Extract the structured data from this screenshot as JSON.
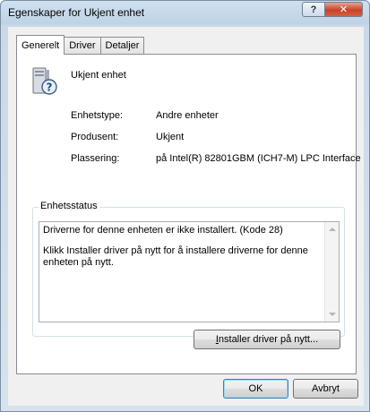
{
  "window": {
    "title": "Egenskaper for Ukjent enhet",
    "help_label": "?",
    "close_label": "✕"
  },
  "tabs": [
    {
      "label": "Generelt",
      "active": true
    },
    {
      "label": "Driver",
      "active": false
    },
    {
      "label": "Detaljer",
      "active": false
    }
  ],
  "device": {
    "name": "Ukjent enhet",
    "icon": "unknown-device-icon"
  },
  "properties": [
    {
      "label": "Enhetstype:",
      "value": "Andre enheter"
    },
    {
      "label": "Produsent:",
      "value": "Ukjent"
    },
    {
      "label": "Plassering:",
      "value": "på Intel(R) 82801GBM (ICH7-M) LPC Interface"
    }
  ],
  "status": {
    "group_title": "Enhetsstatus",
    "line1": "Driverne for denne enheten er ikke installert. (Kode 28)",
    "line2": "Klikk Installer driver på nytt for å installere driverne for denne enheten på nytt."
  },
  "buttons": {
    "install_prefix": "I",
    "install_rest": "nstaller driver på nytt...",
    "ok": "OK",
    "cancel": "Avbryt"
  }
}
